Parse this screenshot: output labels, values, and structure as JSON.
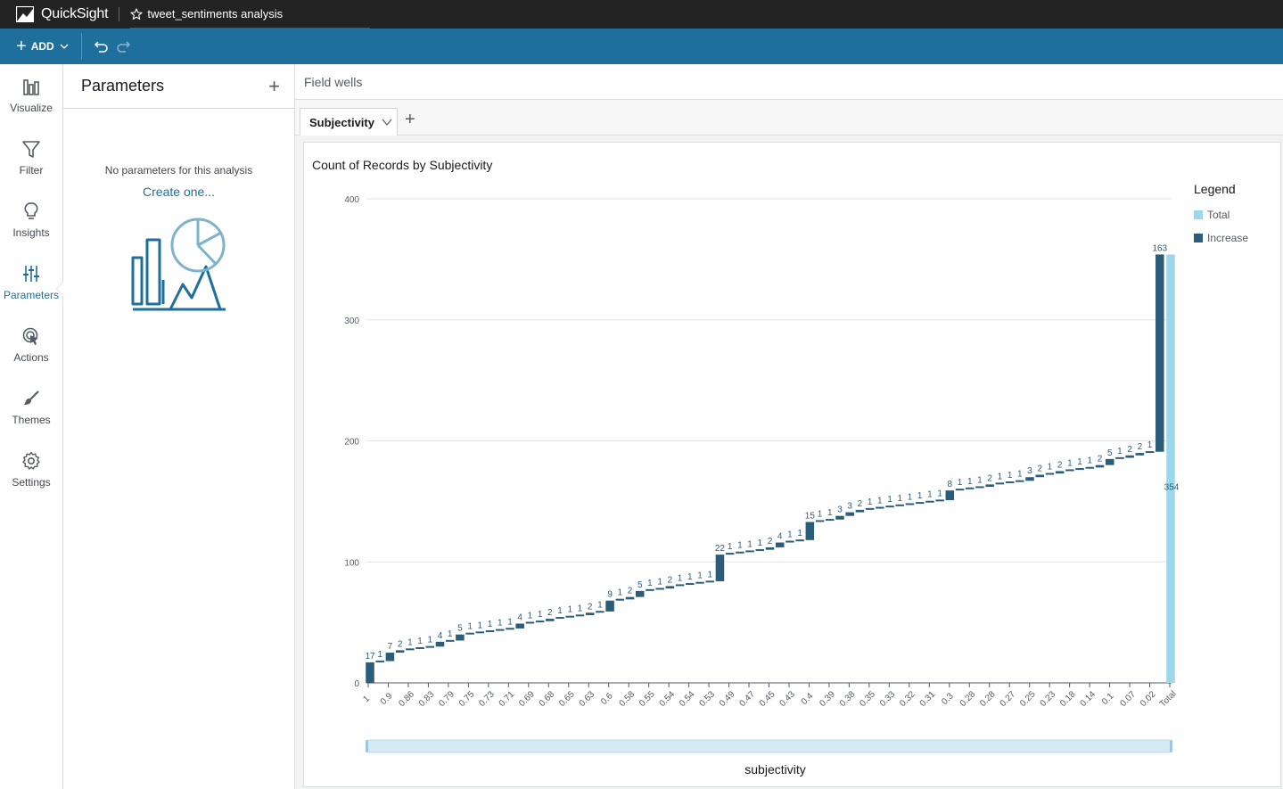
{
  "app": {
    "name": "QuickSight",
    "doc_title": "tweet_sentiments analysis"
  },
  "toolbar": {
    "add_label": "ADD"
  },
  "rail": {
    "items": [
      {
        "label": "Visualize",
        "icon": "bar-chart-icon"
      },
      {
        "label": "Filter",
        "icon": "filter-icon"
      },
      {
        "label": "Insights",
        "icon": "lightbulb-icon"
      },
      {
        "label": "Parameters",
        "icon": "sliders-icon",
        "active": true
      },
      {
        "label": "Actions",
        "icon": "cursor-target-icon"
      },
      {
        "label": "Themes",
        "icon": "brush-icon"
      },
      {
        "label": "Settings",
        "icon": "gear-icon"
      }
    ]
  },
  "panel": {
    "title": "Parameters",
    "empty_text": "No parameters for this analysis",
    "create_link": "Create one..."
  },
  "main": {
    "field_wells": "Field wells",
    "sheet_tab": "Subjectivity"
  },
  "colors": {
    "increase": "#2b5c7a",
    "total": "#9bd8ec",
    "accent": "#1e6f9c",
    "topbar": "#232323"
  },
  "chart_data": {
    "type": "waterfall",
    "title": "Count of Records by Subjectivity",
    "xlabel": "subjectivity",
    "ylabel": "",
    "ylim": [
      0,
      400
    ],
    "yticks": [
      0,
      100,
      200,
      300,
      400
    ],
    "grid": true,
    "legend": {
      "title": "Legend",
      "placement": "top-right",
      "entries": [
        "Total",
        "Increase"
      ]
    },
    "tick_labels": [
      "1",
      "0.9",
      "0.86",
      "0.83",
      "0.79",
      "0.75",
      "0.73",
      "0.71",
      "0.69",
      "0.68",
      "0.65",
      "0.63",
      "0.6",
      "0.58",
      "0.55",
      "0.54",
      "0.54",
      "0.53",
      "0.49",
      "0.47",
      "0.45",
      "0.43",
      "0.4",
      "0.39",
      "0.38",
      "0.35",
      "0.33",
      "0.32",
      "0.31",
      "0.3",
      "0.28",
      "0.28",
      "0.27",
      "0.25",
      "0.23",
      "0.18",
      "0.14",
      "0.1",
      "0.07",
      "0.02",
      "Total"
    ],
    "increments": [
      17,
      1,
      7,
      2,
      1,
      1,
      1,
      4,
      1,
      5,
      1,
      1,
      1,
      1,
      1,
      4,
      1,
      1,
      2,
      1,
      1,
      1,
      2,
      1,
      9,
      1,
      2,
      5,
      1,
      1,
      2,
      1,
      1,
      1,
      1,
      22,
      1,
      1,
      1,
      1,
      2,
      4,
      1,
      1,
      15,
      1,
      1,
      3,
      3,
      2,
      1,
      1,
      1,
      1,
      1,
      1,
      1,
      1,
      8,
      1,
      1,
      1,
      2,
      1,
      1,
      1,
      3,
      2,
      1,
      2,
      1,
      1,
      1,
      2,
      5,
      1,
      2,
      2,
      1,
      163
    ],
    "total": 354
  }
}
